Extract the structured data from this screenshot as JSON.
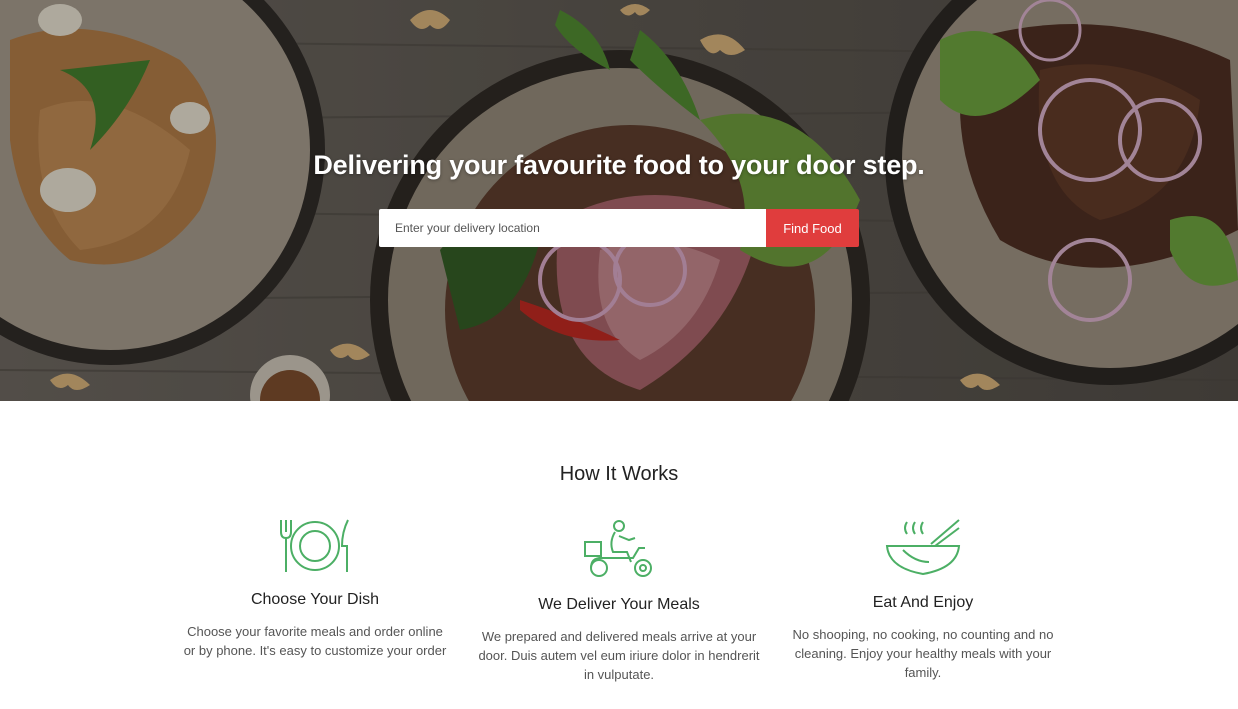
{
  "hero": {
    "title": "Delivering your favourite food to your door step.",
    "search_placeholder": "Enter your delivery location",
    "find_button": "Find Food"
  },
  "how_it_works": {
    "title": "How It Works",
    "steps": [
      {
        "title": "Choose Your Dish",
        "icon": "plate-cutlery-icon",
        "text": "Choose your favorite meals and order online or by phone. It's easy to customize your order"
      },
      {
        "title": "We Deliver Your Meals",
        "icon": "delivery-scooter-icon",
        "text": "We prepared and delivered meals arrive at your door. Duis autem vel eum iriure dolor in hendrerit in vulputate."
      },
      {
        "title": "Eat And Enjoy",
        "icon": "bowl-chopsticks-icon",
        "text": "No shooping, no cooking, no counting and no cleaning. Enjoy your healthy meals with your family."
      }
    ]
  },
  "colors": {
    "accent": "#e03d3d",
    "icon_green": "#4caf65"
  }
}
